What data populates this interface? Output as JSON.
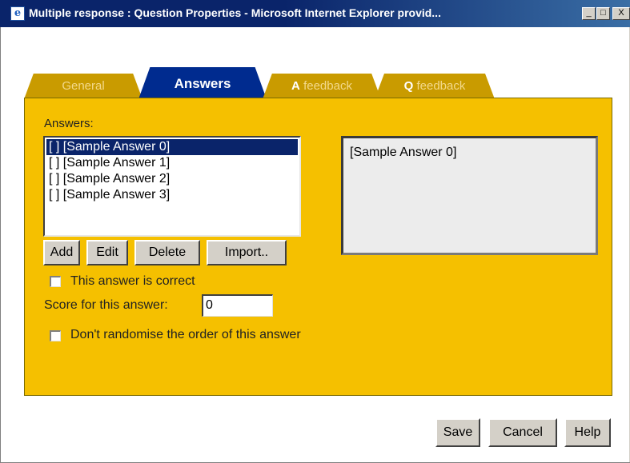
{
  "window": {
    "title": "Multiple response : Question Properties - Microsoft Internet Explorer provid...",
    "icon": "ie-icon",
    "controls": {
      "minimize": "_",
      "maximize": "□",
      "close": "X"
    }
  },
  "tabs": [
    {
      "label": "General",
      "active": false
    },
    {
      "label": "Answers",
      "active": true
    },
    {
      "glyph": "A",
      "label": "feedback",
      "active": false
    },
    {
      "glyph": "Q",
      "label": "feedback",
      "active": false
    }
  ],
  "answers": {
    "heading": "Answers:",
    "items": [
      "[ ] [Sample Answer 0]",
      "[ ] [Sample Answer 1]",
      "[ ] [Sample Answer 2]",
      "[ ] [Sample Answer 3]"
    ],
    "selected_index": 0,
    "preview_text": "[Sample Answer 0]",
    "buttons": {
      "add": "Add",
      "edit": "Edit",
      "delete": "Delete",
      "import": "Import.."
    }
  },
  "options": {
    "correct_label": "This answer is correct",
    "correct_checked": false,
    "score_label": "Score for this answer:",
    "score_value": "0",
    "randomise_label": "Don't randomise the order of this answer",
    "randomise_checked": false
  },
  "footer": {
    "save": "Save",
    "cancel": "Cancel",
    "help": "Help"
  },
  "colors": {
    "panel": "#f5c000",
    "tab_inactive": "#c99b00",
    "tab_active": "#002b8f",
    "titlebar": "#0a246a",
    "selection": "#0a246a"
  }
}
